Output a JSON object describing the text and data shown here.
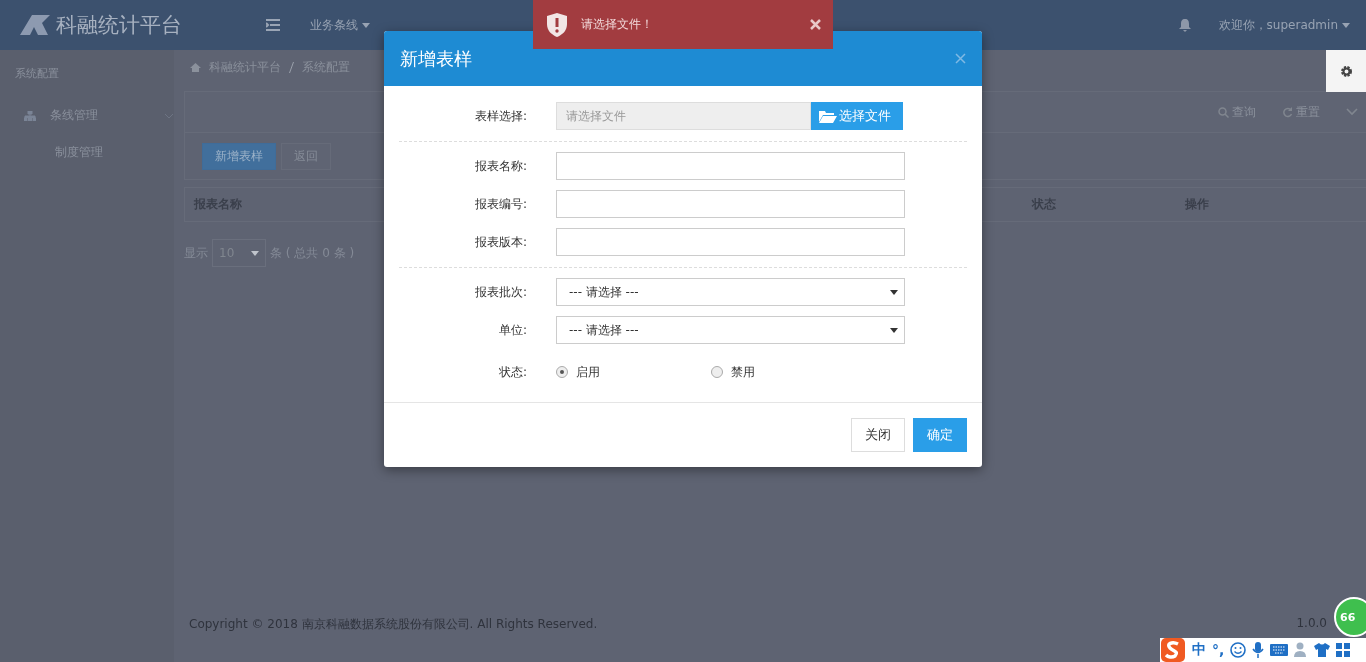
{
  "header": {
    "logo_text": "科融统计平台",
    "menu": "业务条线",
    "welcome": "欢迎你，superadmin"
  },
  "sidebar": {
    "section": "系统配置",
    "items": [
      {
        "label": "条线管理",
        "kind": "group"
      },
      {
        "label": "制度管理",
        "kind": "link"
      }
    ]
  },
  "breadcrumb": [
    "科融统计平台",
    "系统配置"
  ],
  "search_bar": {
    "query": "查询",
    "reset": "重置"
  },
  "actions": [
    {
      "label": "新增表样",
      "kind": "primary"
    },
    {
      "label": "返回",
      "kind": "default"
    }
  ],
  "table": {
    "columns": [
      "报表名称",
      "状态",
      "操作"
    ]
  },
  "pager": {
    "show": "显示",
    "size": "10",
    "summary": "条 ( 总共 0 条 )"
  },
  "footer": {
    "copyright": "Copyright © 2018 南京科融数据系统股份有限公司. All Rights Reserved.",
    "version": "1.0.0"
  },
  "toast": {
    "message": "请选择文件！"
  },
  "modal": {
    "title": "新增表样",
    "file": {
      "label": "表样选择:",
      "placeholder": "请选择文件",
      "button": "选择文件"
    },
    "fields": [
      {
        "label": "报表名称:"
      },
      {
        "label": "报表编号:"
      },
      {
        "label": "报表版本:"
      }
    ],
    "selects": [
      {
        "label": "报表批次:",
        "value": "--- 请选择 ---"
      },
      {
        "label": "单位:",
        "value": "--- 请选择 ---"
      }
    ],
    "status": {
      "label": "状态:",
      "options": [
        {
          "label": "启用",
          "selected": true
        },
        {
          "label": "禁用",
          "selected": false
        }
      ]
    },
    "buttons": [
      {
        "label": "关闭",
        "kind": "default"
      },
      {
        "label": "确定",
        "kind": "primary"
      }
    ]
  },
  "ime": {
    "mode": "中",
    "punct": "°,",
    "badge": "66"
  }
}
